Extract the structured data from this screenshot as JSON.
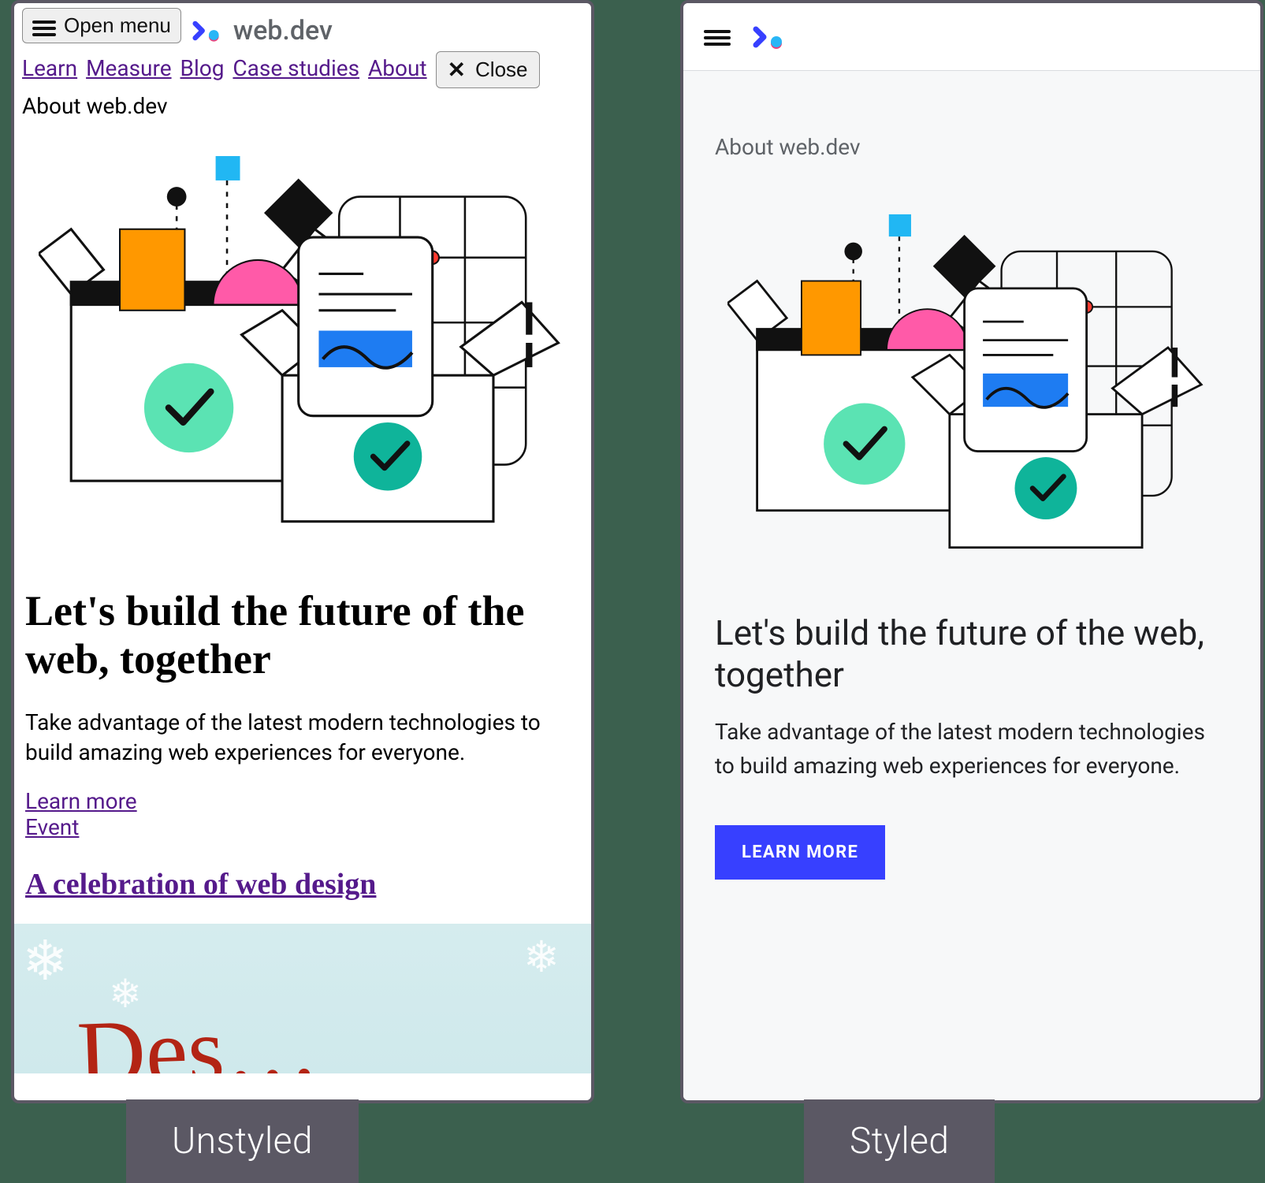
{
  "brand": {
    "name": "web.dev"
  },
  "unstyled": {
    "open_menu": "Open menu",
    "nav": {
      "learn": "Learn",
      "measure": "Measure",
      "blog": "Blog",
      "case_studies": "Case studies",
      "about": "About"
    },
    "close": "Close",
    "about_label": "About web.dev",
    "headline": "Let's build the future of the web, together",
    "sub": "Take advantage of the latest modern technologies to build amazing web experiences for everyone.",
    "learn_more": "Learn more",
    "event": "Event",
    "celebration": "A celebration of web design"
  },
  "styled": {
    "about_label": "About web.dev",
    "headline": "Let's build the future of the web, together",
    "sub": "Take advantage of the latest modern technologies to build amazing web experiences for everyone.",
    "cta": "LEARN MORE"
  },
  "captions": {
    "left": "Unstyled",
    "right": "Styled"
  }
}
